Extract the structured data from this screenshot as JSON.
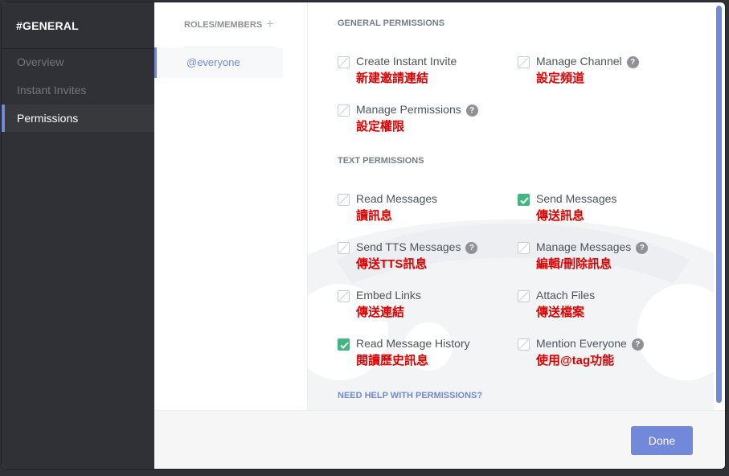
{
  "sidebar": {
    "channel_name": "#GENERAL",
    "items": [
      {
        "label": "Overview"
      },
      {
        "label": "Instant Invites"
      },
      {
        "label": "Permissions"
      }
    ]
  },
  "roles": {
    "title": "ROLES/MEMBERS",
    "add_icon": "plus-icon",
    "selected": "@everyone"
  },
  "sections": {
    "general_title": "GENERAL PERMISSIONS",
    "text_title": "TEXT PERMISSIONS"
  },
  "general_permissions": [
    {
      "label": "Create Instant Invite",
      "annotation": "新建邀請連結",
      "checked": false,
      "help": false
    },
    {
      "label": "Manage Channel",
      "annotation": "設定頻道",
      "checked": false,
      "help": true
    },
    {
      "label": "Manage Permissions",
      "annotation": "設定權限",
      "checked": false,
      "help": true
    }
  ],
  "text_permissions": [
    {
      "label": "Read Messages",
      "annotation": "讀訊息",
      "checked": false,
      "help": false
    },
    {
      "label": "Send Messages",
      "annotation": "傳送訊息",
      "checked": true,
      "help": false
    },
    {
      "label": "Send TTS Messages",
      "annotation": "傳送TTS訊息",
      "checked": false,
      "help": true
    },
    {
      "label": "Manage Messages",
      "annotation": "編輯/刪除訊息",
      "checked": false,
      "help": true
    },
    {
      "label": "Embed Links",
      "annotation": "傳送連結",
      "checked": false,
      "help": false
    },
    {
      "label": "Attach Files",
      "annotation": "傳送檔案",
      "checked": false,
      "help": false
    },
    {
      "label": "Read Message History",
      "annotation": "閱讀歷史訊息",
      "checked": true,
      "help": false
    },
    {
      "label": "Mention Everyone",
      "annotation": "使用@tag功能",
      "checked": false,
      "help": true
    }
  ],
  "help_link": "NEED HELP WITH PERMISSIONS?",
  "help_icon_glyph": "?",
  "footer": {
    "done_label": "Done"
  },
  "colors": {
    "accent": "#7289da",
    "checked": "#43b581",
    "annotation": "#e00000",
    "sidebar_bg": "#2f3136"
  }
}
